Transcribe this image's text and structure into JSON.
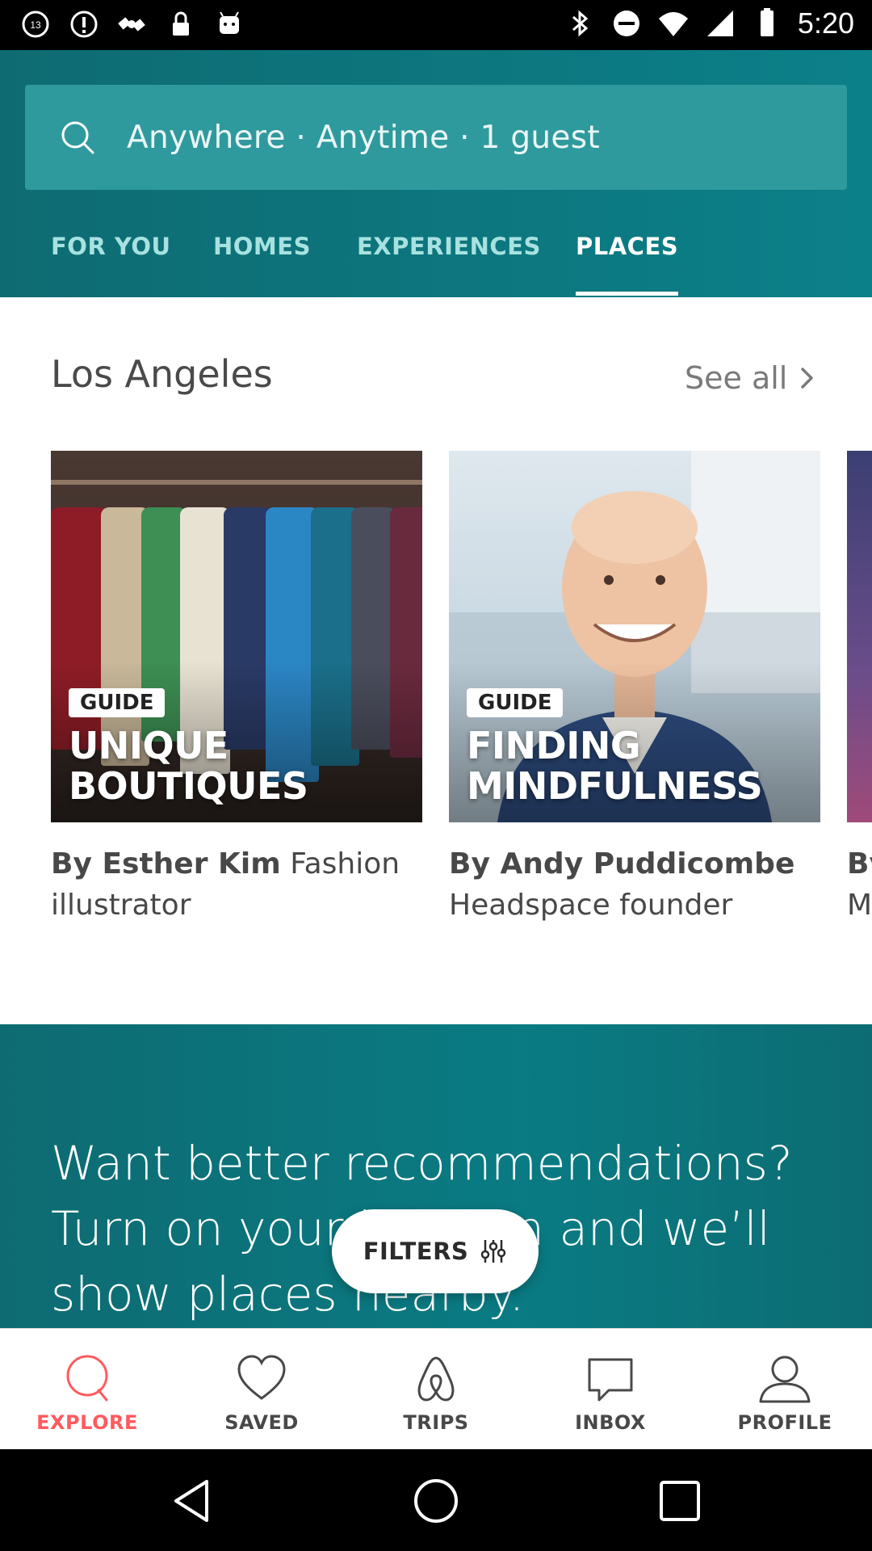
{
  "status_bar": {
    "time": "5:20",
    "left_icons": [
      "abc13-icon",
      "alert-icon",
      "satellite-icon",
      "lock-icon",
      "android-icon"
    ],
    "right_icons": [
      "bluetooth-icon",
      "do-not-disturb-icon",
      "wifi-icon",
      "signal-icon",
      "battery-icon"
    ]
  },
  "search": {
    "placeholder": "Anywhere · Anytime · 1 guest"
  },
  "tabs": [
    {
      "label": "FOR YOU",
      "active": false
    },
    {
      "label": "HOMES",
      "active": false
    },
    {
      "label": "EXPERIENCES",
      "active": false
    },
    {
      "label": "PLACES",
      "active": true
    }
  ],
  "section": {
    "title": "Los Angeles",
    "see_all": "See all"
  },
  "cards": [
    {
      "badge": "GUIDE",
      "title_line1": "UNIQUE",
      "title_line2": "BOUTIQUES",
      "author": "By Esther Kim",
      "role": " Fashion illustrator"
    },
    {
      "badge": "GUIDE",
      "title_line1": "FINDING",
      "title_line2": "MINDFULNESS",
      "author": "By Andy Puddicombe",
      "role": "Headspace founder"
    },
    {
      "author": "By",
      "role": "M"
    }
  ],
  "recommendation": {
    "text": "Want better recommendations? Turn on your location and we’ll show places nearby."
  },
  "filters_button": {
    "label": "FILTERS"
  },
  "bottom_nav": [
    {
      "label": "EXPLORE",
      "icon": "search-icon",
      "active": true
    },
    {
      "label": "SAVED",
      "icon": "heart-icon",
      "active": false
    },
    {
      "label": "TRIPS",
      "icon": "airbnb-logo-icon",
      "active": false
    },
    {
      "label": "INBOX",
      "icon": "chat-bubble-icon",
      "active": false
    },
    {
      "label": "PROFILE",
      "icon": "person-icon",
      "active": false
    }
  ],
  "colors": {
    "teal": "#0c7a82",
    "accent": "#ff5a5f",
    "tab_inactive": "#a7e2e0"
  }
}
